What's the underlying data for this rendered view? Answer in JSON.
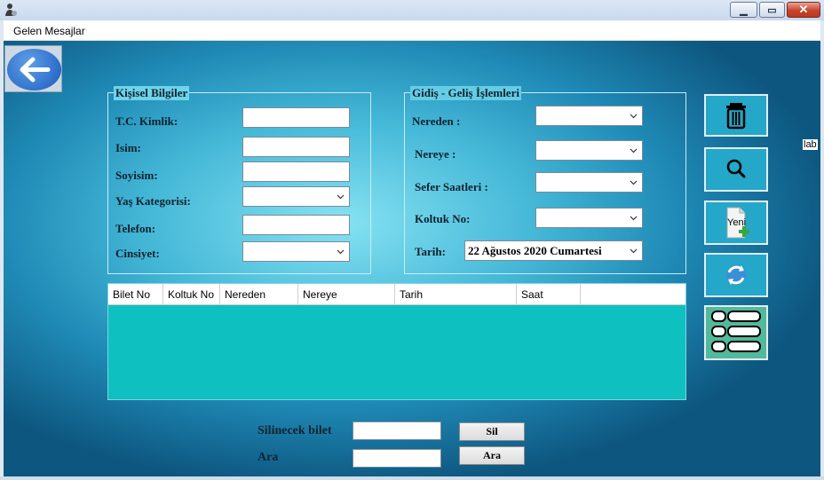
{
  "menu": {
    "item": "Gelen Mesajlar"
  },
  "personal": {
    "legend": "Kişisel Bilgiler",
    "labels": {
      "tc": "T.C. Kimlik:",
      "isim": "Isim:",
      "soyisim": "Soyisim:",
      "yas": "Yaş Kategorisi:",
      "telefon": "Telefon:",
      "cinsiyet": "Cinsiyet:"
    }
  },
  "travel": {
    "legend": "Gidiş - Geliş İşlemleri",
    "labels": {
      "nereden": "Nereden :",
      "nereye": "Nereye :",
      "sefer": "Sefer Saatleri :",
      "koltuk": "Koltuk No:",
      "tarih": "Tarih:"
    },
    "tarih_value": "22 Ağustos  2020 Cumartesi"
  },
  "grid": {
    "columns": [
      "Bilet No",
      "Koltuk No",
      "Nereden",
      "Nereye",
      "Tarih",
      "Saat"
    ]
  },
  "side": {
    "buttons": [
      "delete-icon",
      "search-icon",
      "new-document-icon",
      "refresh-icon",
      "list-icon"
    ],
    "new_label": "Yeni",
    "edge_label": "lab"
  },
  "bottom": {
    "silinecek_label": "Silinecek bilet",
    "ara_label": "Ara",
    "sil_button": "Sil",
    "ara_button": "Ara"
  },
  "colors": {
    "grid_background": "#0fc0c0",
    "side_button": "#24a7c8",
    "accent_blue": "#2f6fca"
  }
}
